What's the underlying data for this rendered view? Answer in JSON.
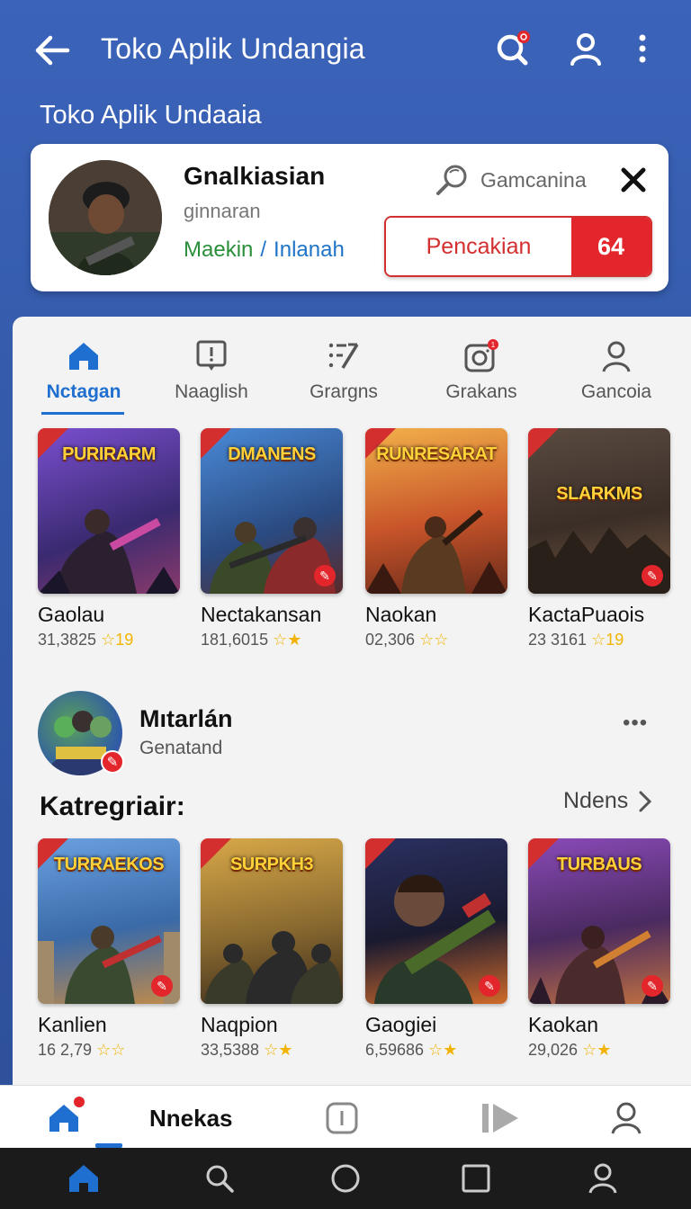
{
  "appbar": {
    "title": "Toko Aplik Undangia",
    "icons": [
      "back-arrow-icon",
      "search-icon",
      "account-icon",
      "more-vert-icon"
    ]
  },
  "subtitle": "Toko Aplik Undaaia",
  "profile": {
    "name": "Gnalkiasian",
    "subtitle": "ginnaran",
    "link_primary": "Maekin",
    "link_sep": "/",
    "link_secondary": "Inlanah",
    "search_label": "Gamcanina",
    "action_label": "Pencakian",
    "action_count": "64"
  },
  "tabs": [
    {
      "label": "Nctagan",
      "icon": "home-icon",
      "active": true
    },
    {
      "label": "Naaglish",
      "icon": "alert-box-icon",
      "active": false
    },
    {
      "label": "Grargns",
      "icon": "list-edit-icon",
      "active": false
    },
    {
      "label": "Grakans",
      "icon": "camera-icon",
      "active": false
    },
    {
      "label": "Gancoia",
      "icon": "person-icon",
      "active": false
    }
  ],
  "games_row1": [
    {
      "name": "Gaolau",
      "meta": "31,3825",
      "rating": "19",
      "thumb_title": "PURIRARM",
      "color": "#5a3fa8"
    },
    {
      "name": "Nectakansan",
      "meta": "181,6015",
      "rating": "",
      "thumb_title": "DMANENS",
      "color": "#2d6fb8"
    },
    {
      "name": "Naokan",
      "meta": "02,306",
      "rating": "",
      "thumb_title": "RUNRESARAT",
      "color": "#d07a2a"
    },
    {
      "name": "KactaPuaois",
      "meta": "23 3161",
      "rating": "19",
      "thumb_title": "SLARKMS",
      "color": "#4a3a30"
    }
  ],
  "developer": {
    "name": "Mıtarlán",
    "subtitle": "Genatand",
    "more": "•••"
  },
  "section": {
    "title": "Katregriair:",
    "see_all": "Ndens"
  },
  "games_row2": [
    {
      "name": "Kanlien",
      "meta": "16 2,79",
      "rating": "",
      "thumb_title": "TURRAEKOS",
      "color": "#3d6fb0"
    },
    {
      "name": "Naqpion",
      "meta": "33,5388",
      "rating": "",
      "thumb_title": "SURPKH3",
      "color": "#b08a2a"
    },
    {
      "name": "Gaogiei",
      "meta": "6,59686",
      "rating": "",
      "thumb_title": "",
      "color": "#3a3050"
    },
    {
      "name": "Kaokan",
      "meta": "29,026",
      "rating": "",
      "thumb_title": "TURBAUS",
      "color": "#6a3a7a"
    }
  ],
  "bottom_nav": {
    "label": "Nnekas",
    "icons": [
      "home-icon",
      "alert-box-icon",
      "play-icon",
      "person-icon"
    ]
  },
  "system_nav": [
    "home-icon",
    "search-icon",
    "circle-icon",
    "square-icon",
    "person-icon"
  ],
  "colors": {
    "header_blue": "#3b63b9",
    "accent_red": "#e3262b",
    "active_blue": "#1f6fd1",
    "link_green": "#2a8f3a"
  }
}
